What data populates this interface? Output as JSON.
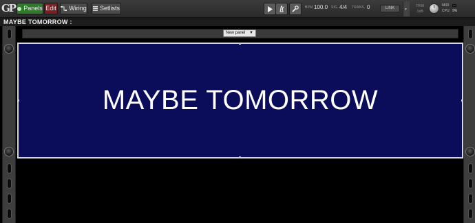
{
  "app": {
    "logo_text": "GP"
  },
  "toolbar": {
    "panels_label": "Panels",
    "edit_label": "Edit",
    "wiring_label": "Wiring",
    "setlists_label": "Setlists",
    "bpm_label": "BPM",
    "bpm_value": "100.0",
    "sig_label": "SIG.",
    "sig_value": "4/4",
    "trans_label": "TRANS.",
    "trans_value": "0",
    "link_label": "LINK",
    "trim_label": "TRIM",
    "trim_value": "0dB",
    "midi_label": "MIDI",
    "cpu_label": "CPU:",
    "cpu_value": "9%"
  },
  "rackspace": {
    "title": "MAYBE TOMORROW :"
  },
  "panel": {
    "selected_panel": "New panel",
    "display_text": "MAYBE TOMORROW",
    "background_color": "#0c0d5a",
    "text_color": "#ffffff"
  },
  "colors": {
    "panels_active": "#2e7a2a",
    "edit_active": "#7a1f1f"
  }
}
